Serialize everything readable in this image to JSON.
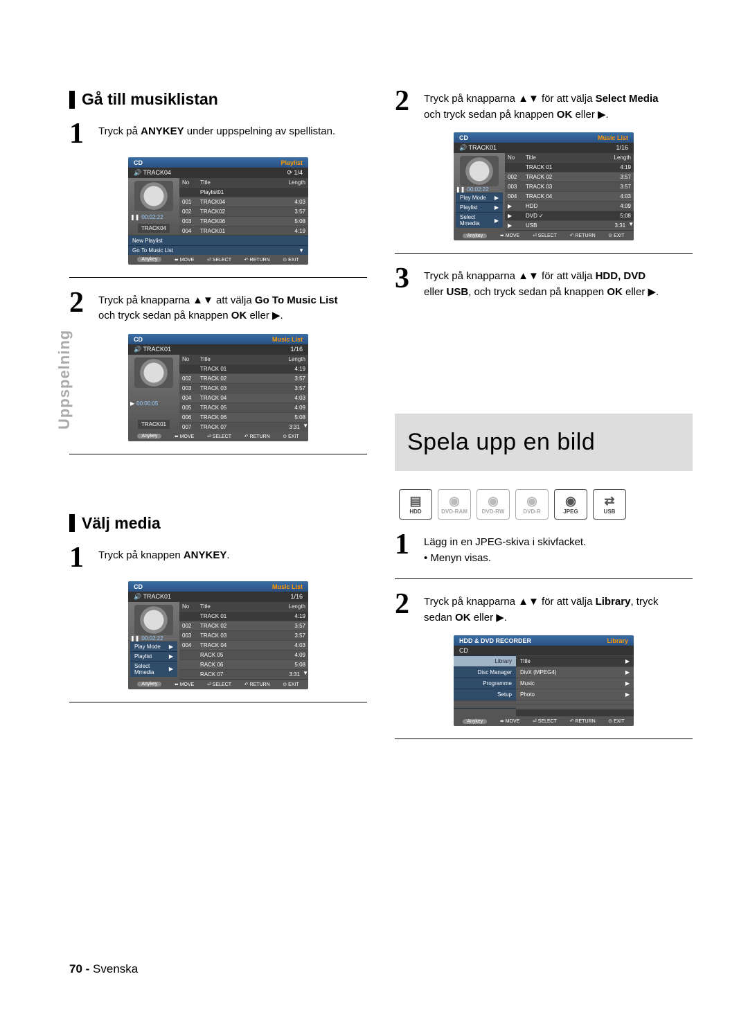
{
  "side_tab": "Uppspelning",
  "page_footer": {
    "num": "70 -",
    "lang": "Svenska"
  },
  "left": {
    "section1": {
      "title": "Gå till musiklistan",
      "step1": {
        "num": "1",
        "pre": "Tryck på ",
        "bold": "ANYKEY",
        "post": " under uppspelning av spellistan."
      },
      "step2": {
        "num": "2",
        "line1_pre": "Tryck på knapparna ▲▼ att välja ",
        "line1_bold": "Go To Music List",
        "line2": "och tryck sedan på knappen ",
        "line2_bold": "OK",
        "line2_post": " eller ▶."
      }
    },
    "section2": {
      "title": "Välj media",
      "step1": {
        "num": "1",
        "pre": "Tryck på knappen ",
        "bold": "ANYKEY",
        "post": "."
      }
    }
  },
  "right": {
    "step2": {
      "num": "2",
      "line1_pre": "Tryck på knapparna ▲▼ för att välja ",
      "line1_bold": "Select Media",
      "line2": "och tryck sedan på knappen ",
      "line2_bold": "OK",
      "line2_post": " eller ▶."
    },
    "step3": {
      "num": "3",
      "line1_pre": "Tryck på knapparna ▲▼ för att välja ",
      "line1_bold": "HDD, DVD",
      "line2_pre": "eller ",
      "line2_bold1": "USB",
      "line2_mid": ",  och tryck sedan på knappen ",
      "line2_bold2": "OK",
      "line2_post": " eller  ▶."
    },
    "headline": "Spela upp en bild",
    "media_icons": [
      "HDD",
      "DVD-RAM",
      "DVD-RW",
      "DVD-R",
      "JPEG",
      "USB"
    ],
    "stepA": {
      "num": "1",
      "line1": "Lägg in en JPEG-skiva i skivfacket.",
      "line2": "• Menyn visas."
    },
    "stepB": {
      "num": "2",
      "line1_pre": "Tryck på knapparna ▲▼ för att välja ",
      "line1_bold": "Library",
      "line1_post": ", tryck",
      "line2_pre": "sedan ",
      "line2_bold": "OK",
      "line2_post": " eller ▶."
    }
  },
  "screens": {
    "s1": {
      "top_left": "CD",
      "top_right": "Playlist",
      "sub_left": "TRACK04",
      "sub_right": "1/4",
      "time": "00:02:22",
      "now": "TRACK04",
      "cols": [
        "No",
        "Title",
        "Length"
      ],
      "rows": [
        {
          "no": "",
          "title": "Playlist01",
          "len": ""
        },
        {
          "no": "001",
          "title": "TRACK04",
          "len": "4:03"
        },
        {
          "no": "002",
          "title": "TRACK02",
          "len": "3:57"
        },
        {
          "no": "003",
          "title": "TRACK06",
          "len": "5:08"
        },
        {
          "no": "004",
          "title": "TRACK01",
          "len": "4:19"
        }
      ],
      "menu": [
        "New Playlist",
        "Go To Music List"
      ],
      "foot": {
        "anykey": "Anykey",
        "move": "MOVE",
        "select": "SELECT",
        "return": "RETURN",
        "exit": "EXIT"
      }
    },
    "s2": {
      "top_left": "CD",
      "top_right": "Music List",
      "sub_left": "TRACK01",
      "sub_right": "1/16",
      "time": "00:00:05",
      "now": "TRACK01",
      "cols": [
        "No",
        "Title",
        "Length"
      ],
      "rows": [
        {
          "no": "",
          "title": "TRACK 01",
          "len": "4:19"
        },
        {
          "no": "002",
          "title": "TRACK 02",
          "len": "3:57"
        },
        {
          "no": "003",
          "title": "TRACK 03",
          "len": "3:57"
        },
        {
          "no": "004",
          "title": "TRACK 04",
          "len": "4:03"
        },
        {
          "no": "005",
          "title": "TRACK 05",
          "len": "4:09"
        },
        {
          "no": "006",
          "title": "TRACK 06",
          "len": "5:08"
        },
        {
          "no": "007",
          "title": "TRACK 07",
          "len": "3:31"
        }
      ],
      "foot": {
        "anykey": "Anykey",
        "move": "MOVE",
        "select": "SELECT",
        "return": "RETURN",
        "exit": "EXIT"
      }
    },
    "s3": {
      "top_left": "CD",
      "top_right": "Music List",
      "sub_left": "TRACK01",
      "sub_right": "1/16",
      "time": "00:02:22",
      "cols": [
        "No",
        "Title",
        "Length"
      ],
      "rows": [
        {
          "no": "",
          "title": "TRACK 01",
          "len": "4:19"
        },
        {
          "no": "002",
          "title": "TRACK 02",
          "len": "3:57"
        },
        {
          "no": "003",
          "title": "TRACK 03",
          "len": "3:57"
        },
        {
          "no": "004",
          "title": "TRACK 04",
          "len": "4:03"
        },
        {
          "no": "",
          "title": "RACK 05",
          "len": "4:09"
        },
        {
          "no": "",
          "title": "RACK 06",
          "len": "5:08"
        },
        {
          "no": "",
          "title": "RACK 07",
          "len": "3:31"
        }
      ],
      "menu": [
        "Play Mode",
        "Playlist",
        "Select Mmedia"
      ],
      "foot": {
        "anykey": "Anykey",
        "move": "MOVE",
        "select": "SELECT",
        "return": "RETURN",
        "exit": "EXIT"
      }
    },
    "s4": {
      "top_left": "CD",
      "top_right": "Music List",
      "sub_left": "TRACK01",
      "sub_right": "1/16",
      "time": "00:02:22",
      "cols": [
        "No",
        "Title",
        "Length"
      ],
      "rows": [
        {
          "no": "",
          "title": "TRACK 01",
          "len": "4:19"
        },
        {
          "no": "002",
          "title": "TRACK 02",
          "len": "3:57"
        },
        {
          "no": "003",
          "title": "TRACK 03",
          "len": "3:57"
        },
        {
          "no": "004",
          "title": "TRACK 04",
          "len": "4:03"
        },
        {
          "no": "",
          "title": "HDD",
          "len": "4:09"
        },
        {
          "no": "",
          "title": "DVD        ✓",
          "len": "5:08"
        },
        {
          "no": "",
          "title": "USB",
          "len": "3:31"
        }
      ],
      "menu": [
        "Play Mode",
        "Playlist",
        "Select Mmedia"
      ],
      "foot": {
        "anykey": "Anykey",
        "move": "MOVE",
        "select": "SELECT",
        "return": "RETURN",
        "exit": "EXIT"
      }
    },
    "s5": {
      "top_left": "HDD & DVD RECORDER",
      "top_right": "Library",
      "sub_left": "CD",
      "left_items": [
        "Library",
        "Disc Manager",
        "Programme",
        "Setup"
      ],
      "right_items": [
        "Title",
        "DivX (MPEG4)",
        "Music",
        "Photo"
      ],
      "foot": {
        "anykey": "Anykey",
        "move": "MOVE",
        "select": "SELECT",
        "return": "RETURN",
        "exit": "EXIT"
      }
    }
  }
}
